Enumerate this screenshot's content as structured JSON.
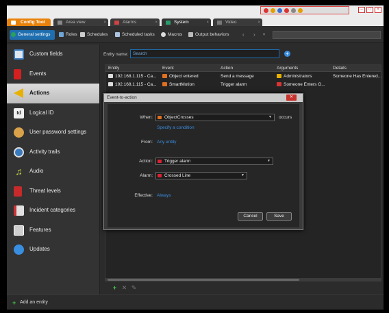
{
  "tabs": [
    {
      "label": "Config Tool",
      "icon": "config-tool-icon"
    },
    {
      "label": "Area view",
      "icon": "area-view-icon"
    },
    {
      "label": "Alarms",
      "icon": "alarm-icon"
    },
    {
      "label": "System",
      "icon": "system-icon"
    },
    {
      "label": "Video",
      "icon": "video-icon"
    }
  ],
  "toolbar": {
    "items": [
      "General settings",
      "Roles",
      "Schedules",
      "Scheduled tasks",
      "Macros",
      "Output behaviors"
    ]
  },
  "sidebar": {
    "items": [
      {
        "label": "Custom fields",
        "icon": "custom-fields-icon"
      },
      {
        "label": "Events",
        "icon": "flag-icon"
      },
      {
        "label": "Actions",
        "icon": "megaphone-icon"
      },
      {
        "label": "Logical ID",
        "icon": "id-icon"
      },
      {
        "label": "User password settings",
        "icon": "user-icon"
      },
      {
        "label": "Activity trails",
        "icon": "clock-icon"
      },
      {
        "label": "Audio",
        "icon": "music-note-icon"
      },
      {
        "label": "Threat levels",
        "icon": "threat-flag-icon"
      },
      {
        "label": "Incident categories",
        "icon": "incident-icon"
      },
      {
        "label": "Features",
        "icon": "license-icon"
      },
      {
        "label": "Updates",
        "icon": "cloud-download-icon"
      }
    ]
  },
  "main": {
    "entity_name_label": "Entity name:",
    "search_placeholder": "Search",
    "columns": [
      "Entity",
      "Event",
      "Action",
      "Arguments",
      "Details"
    ],
    "rows": [
      {
        "entity": "192.168.1.115 - Ca...",
        "event": "Object entered",
        "action": "Send a message",
        "arguments": "Administrators",
        "details": "Someone Has Entered..."
      },
      {
        "entity": "192.168.1.115 - Ca...",
        "event": "SmartMotion",
        "action": "Trigger alarm",
        "arguments": "Someone Enters G...",
        "details": ""
      }
    ]
  },
  "bottom": {
    "add_entity": "Add an entity"
  },
  "dialog": {
    "title": "Event-to-action",
    "when_label": "When:",
    "when_value": "ObjectCrosses",
    "occurs": "occurs",
    "specify_condition": "Specify a condition",
    "from_label": "From:",
    "from_value": "Any entity",
    "action_label": "Action:",
    "action_value": "Trigger alarm",
    "alarm_label": "Alarm:",
    "alarm_value": "Crossed Line",
    "effective_label": "Effective:",
    "effective_value": "Always",
    "cancel": "Cancel",
    "save": "Save"
  }
}
